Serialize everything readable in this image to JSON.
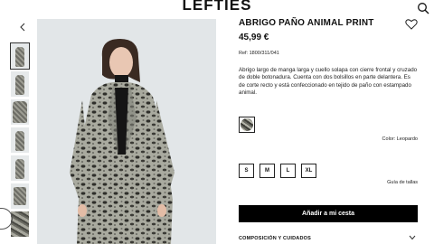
{
  "header": {
    "brand": "LEFTIES",
    "search_icon": "search-icon"
  },
  "gallery": {
    "prev_icon": "chevron-left-icon",
    "thumbnails": [
      "front-full",
      "front-full",
      "detail-print",
      "front-walk",
      "side",
      "flat-lay",
      "fabric-texture"
    ]
  },
  "product": {
    "name": "ABRIGO PAÑO ANIMAL PRINT",
    "price": "45,99 €",
    "ref": "Ref: 1800/311/041",
    "description": "Abrigo largo de manga larga y cuello solapa con cierre frontal y cruzado de doble botonadura. Cuenta con dos bolsillos en parte delantera. Es de corte recto y está confeccionado en tejido de paño con estampado animal.",
    "color_label": "Color: Leopardo",
    "sizes": [
      "S",
      "M",
      "L",
      "XL"
    ],
    "size_guide": "Guía de tallas",
    "add_to_cart": "Añadir a mi cesta",
    "composition": "COMPOSICIÓN Y CUIDADOS"
  },
  "colors": {
    "button": "#000000",
    "background": "#ffffff",
    "photo_bg": "#e2e6e8"
  }
}
